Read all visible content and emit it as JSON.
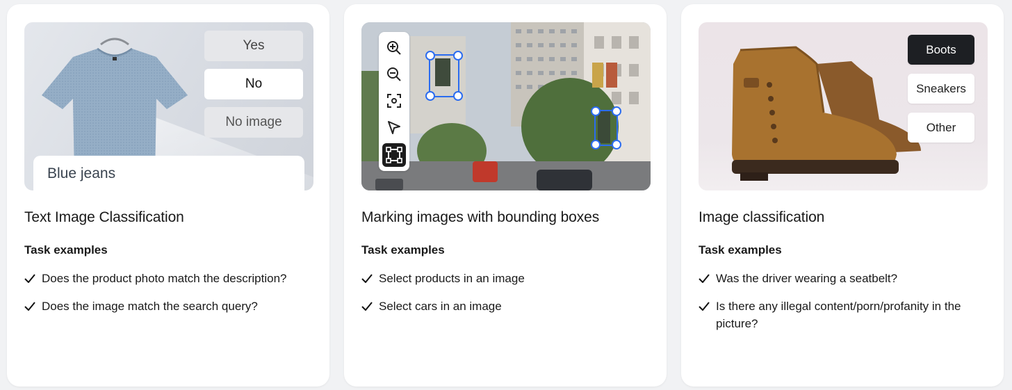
{
  "cards": [
    {
      "title": "Text Image Classification",
      "subhead": "Task examples",
      "options": [
        "Yes",
        "No",
        "No image"
      ],
      "selected_option": "No",
      "input_text": "Blue jeans",
      "examples": [
        "Does the product photo match the description?",
        "Does the image match the search query?"
      ]
    },
    {
      "title": "Marking images with bounding boxes",
      "subhead": "Task examples",
      "tools": [
        "zoom-in-icon",
        "zoom-out-icon",
        "fit-screen-icon",
        "pointer-icon",
        "bounding-box-icon"
      ],
      "active_tool": "bounding-box-icon",
      "examples": [
        "Select products in an image",
        "Select cars in an image"
      ]
    },
    {
      "title": "Image classification",
      "subhead": "Task examples",
      "options": [
        "Boots",
        "Sneakers",
        "Other"
      ],
      "selected_option": "Boots",
      "examples": [
        "Was the driver wearing a seatbelt?",
        "Is there any illegal content/porn/profanity in the picture?"
      ]
    }
  ],
  "colors": {
    "background": "#f1f2f4",
    "card": "#ffffff",
    "box_accent": "#2b6cf0",
    "selected_chip": "#1d1f23"
  }
}
